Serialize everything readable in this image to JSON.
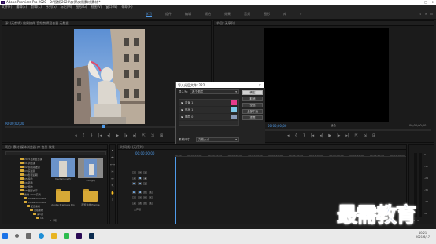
{
  "titlebar": {
    "app_icon": "Pr",
    "title": "Adobe Premiere Pro 2020 - D:\\视频\\2020\\实例\\实例素材\\素材 *",
    "controls": [
      "—",
      "▢",
      "✕"
    ]
  },
  "menu": [
    "文件(F)",
    "编辑(E)",
    "剪辑(C)",
    "序列(S)",
    "标记(M)",
    "图形(G)",
    "视图(V)",
    "窗口(W)",
    "帮助(H)"
  ],
  "workspaces": {
    "tabs": [
      "学习",
      "组件",
      "编辑",
      "颜色",
      "效果",
      "音频",
      "图形",
      "库"
    ],
    "active": "学习",
    "more": "»"
  },
  "source_monitor": {
    "header": "源: (无剪辑)   效果控件   音频剪辑混合器   元数据",
    "timecode_left": "00;00;00;00",
    "fit": "适合",
    "timecode_right": "00;00;05;00",
    "transport": [
      "◂",
      "{",
      "}",
      "|◂",
      "◂|",
      "▶",
      "|▸",
      "▸|",
      "⇱",
      "⇲",
      "⊞"
    ]
  },
  "program_monitor": {
    "header": "节目: 无序列",
    "timecode_left": "00;00;00;00",
    "fit": "适合",
    "timecode_right": "00;00;00;00",
    "transport": [
      "◂",
      "{",
      "}",
      "|◂",
      "◂|",
      "▶",
      "|▸",
      "▸|",
      "⇱",
      "⇲",
      "⊞"
    ]
  },
  "dialog": {
    "title": "导入分层文件: 222",
    "close": "✕",
    "import_as_label": "导入为:",
    "import_as_value": "各个图层",
    "layers": [
      {
        "name": "背景 1",
        "checked": true,
        "thumb_color": "#e63c8c"
      },
      {
        "name": "形状 1",
        "checked": true,
        "thumb_color": "#7ec8e8"
      },
      {
        "name": "图层 0",
        "checked": true,
        "thumb_color": "#8a9bb8"
      }
    ],
    "buttons": [
      "确定",
      "取消",
      "全选",
      "全部不选",
      "重置"
    ],
    "footage_label": "素材尺寸:",
    "footage_value": "文档大小"
  },
  "project": {
    "header": "项目: 素材    媒体浏览器    库    信息    效果",
    "bins": [
      "2021最新会员课",
      "01.调色课",
      "02.剪辑基础课",
      "03.实战篇",
      "04.影视后期",
      "05.综合",
      "06.转场",
      "07.特效",
      "08.图形文字",
      "素材-2020实例",
      "Adobe Premiere",
      "Adobe Premiere",
      "配置素材",
      "旧版素材",
      "第1课",
      "1.1",
      "1.2",
      "1.3"
    ],
    "items": [
      {
        "label": "MediaCore.Pi",
        "type": "thumb"
      },
      {
        "label": "222.jpg",
        "type": "thumb"
      },
      {
        "label": "Adobe Premiere Pro",
        "type": "folder"
      },
      {
        "label": "配置素材 Premie",
        "type": "folder"
      }
    ],
    "count": "4 个项"
  },
  "tools": [
    "▸",
    "⇹",
    "⟷",
    "✂",
    "↔",
    "✎",
    "✋",
    "T"
  ],
  "timeline": {
    "header": "时间线: (无序列)",
    "timecode": "00;00;00;00",
    "ruler": [
      "00;00",
      "00;00;16;00",
      "00;00;32;00",
      "00;00;48;00",
      "00;01;04;00",
      "00;01;20;00",
      "00;01;36;00",
      "00;01;52;00",
      "00;02;08;00",
      "00;02;24;00",
      "00;02;40;00",
      "00;02;56;00"
    ],
    "video_tracks": [
      "V3",
      "V2",
      "V1"
    ],
    "audio_tracks": [
      "A1",
      "A2",
      "A3"
    ],
    "master": "主声道"
  },
  "meters": {
    "scale": [
      "0",
      "-12",
      "-24",
      "-36",
      "-48",
      "dB"
    ],
    "buttons": [
      "S",
      "S"
    ]
  },
  "taskbar": {
    "apps": [
      {
        "name": "windows-start-icon",
        "color": "#1a73e8"
      },
      {
        "name": "search-icon",
        "color": "#6b6b6b"
      },
      {
        "name": "task-view-icon",
        "color": "#6b6b6b"
      },
      {
        "name": "edge-icon",
        "color": "#1f8fd6"
      },
      {
        "name": "explorer-icon",
        "color": "#e8b422"
      },
      {
        "name": "wechat-icon",
        "color": "#2dbd4f"
      },
      {
        "name": "premiere-icon",
        "color": "#2a0a55"
      },
      {
        "name": "photoshop-icon",
        "color": "#0b2c4f"
      }
    ],
    "time": "10:21",
    "date": "2021/6/17"
  },
  "watermark": "最需教育"
}
